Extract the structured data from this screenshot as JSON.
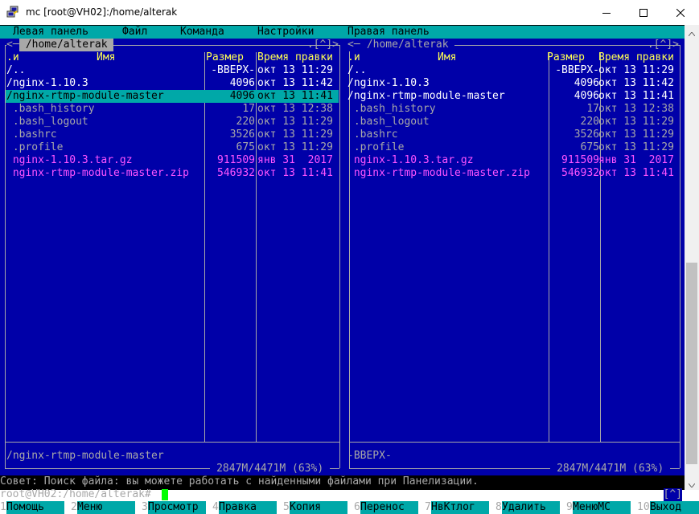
{
  "window": {
    "title": "mc [root@VH02]:/home/alterak",
    "icon": "putty-icon",
    "minimize_icon": "minimize-icon",
    "maximize_icon": "maximize-icon",
    "close_icon": "close-icon"
  },
  "menu": [
    "Левая панель",
    "Файл",
    "Команда",
    "Настройки",
    "Правая панель"
  ],
  "left_panel": {
    "path": " /home/alterak ",
    "corner": "<─",
    "hist": ".[^]>",
    "col_n": ".и",
    "col_name": "Имя",
    "col_size": "Размер",
    "col_time": "Время правки",
    "rows": [
      {
        "name": "/..",
        "size": "-ВВЕРХ-",
        "time": "окт 13 11:29"
      },
      {
        "name": "/nginx-1.10.3",
        "size": "4096",
        "time": "окт 13 11:42"
      },
      {
        "name": "/nginx-rtmp-module-master",
        "size": "4096",
        "time": "окт 13 11:41"
      },
      {
        "name": " .bash_history",
        "size": "17",
        "time": "окт 13 12:38"
      },
      {
        "name": " .bash_logout",
        "size": "220",
        "time": "окт 13 11:29"
      },
      {
        "name": " .bashrc",
        "size": "3526",
        "time": "окт 13 11:29"
      },
      {
        "name": " .profile",
        "size": "675",
        "time": "окт 13 11:29"
      },
      {
        "name": " nginx-1.10.3.tar.gz",
        "size": "911509",
        "time": "янв 31  2017"
      },
      {
        "name": " nginx-rtmp-module-master.zip",
        "size": "546932",
        "time": "окт 13 11:41"
      }
    ],
    "status": "/nginx-rtmp-module-master",
    "free": " 2847M/4471M (63%) "
  },
  "right_panel": {
    "path": " /home/alterak ",
    "corner": "<─",
    "hist": ".[^]>",
    "col_n": ".и",
    "col_name": "Имя",
    "col_size": "Размер",
    "col_time": "Время правки",
    "rows": [
      {
        "name": "/..",
        "size": "-ВВЕРХ-",
        "time": "окт 13 11:29"
      },
      {
        "name": "/nginx-1.10.3",
        "size": "4096",
        "time": "окт 13 11:42"
      },
      {
        "name": "/nginx-rtmp-module-master",
        "size": "4096",
        "time": "окт 13 11:41"
      },
      {
        "name": " .bash_history",
        "size": "17",
        "time": "окт 13 12:38"
      },
      {
        "name": " .bash_logout",
        "size": "220",
        "time": "окт 13 11:29"
      },
      {
        "name": " .bashrc",
        "size": "3526",
        "time": "окт 13 11:29"
      },
      {
        "name": " .profile",
        "size": "675",
        "time": "окт 13 11:29"
      },
      {
        "name": " nginx-1.10.3.tar.gz",
        "size": "911509",
        "time": "янв 31  2017"
      },
      {
        "name": " nginx-rtmp-module-master.zip",
        "size": "546932",
        "time": "окт 13 11:41"
      }
    ],
    "status": "-ВВЕРХ-",
    "free": " 2847M/4471M (63%) "
  },
  "hint": "Совет: Поиск файла: вы можете работать с найденными файлами при Панелизации.",
  "prompt": "root@VH02:/home/alterak#",
  "prompt_hist": "[^]",
  "fkeys": [
    {
      "num": "1",
      "label": "Помощь"
    },
    {
      "num": "2",
      "label": "Меню"
    },
    {
      "num": "3",
      "label": "Просмотр"
    },
    {
      "num": "4",
      "label": "Правка"
    },
    {
      "num": "5",
      "label": "Копия"
    },
    {
      "num": "6",
      "label": "Перенос"
    },
    {
      "num": "7",
      "label": "НвКтлог"
    },
    {
      "num": "8",
      "label": "Удалить"
    },
    {
      "num": "9",
      "label": "МенюMC"
    },
    {
      "num": "10",
      "label": "Выход"
    }
  ],
  "colors": {
    "panel_bg": "#0000a8",
    "text": "#a8a8a8",
    "dir": "#ffffff",
    "header": "#ffff54",
    "archive": "#ff54ff",
    "cursor_bg": "#00a8a8",
    "cursor_fg": "#000000",
    "prompt_cursor": "#00ff00"
  }
}
